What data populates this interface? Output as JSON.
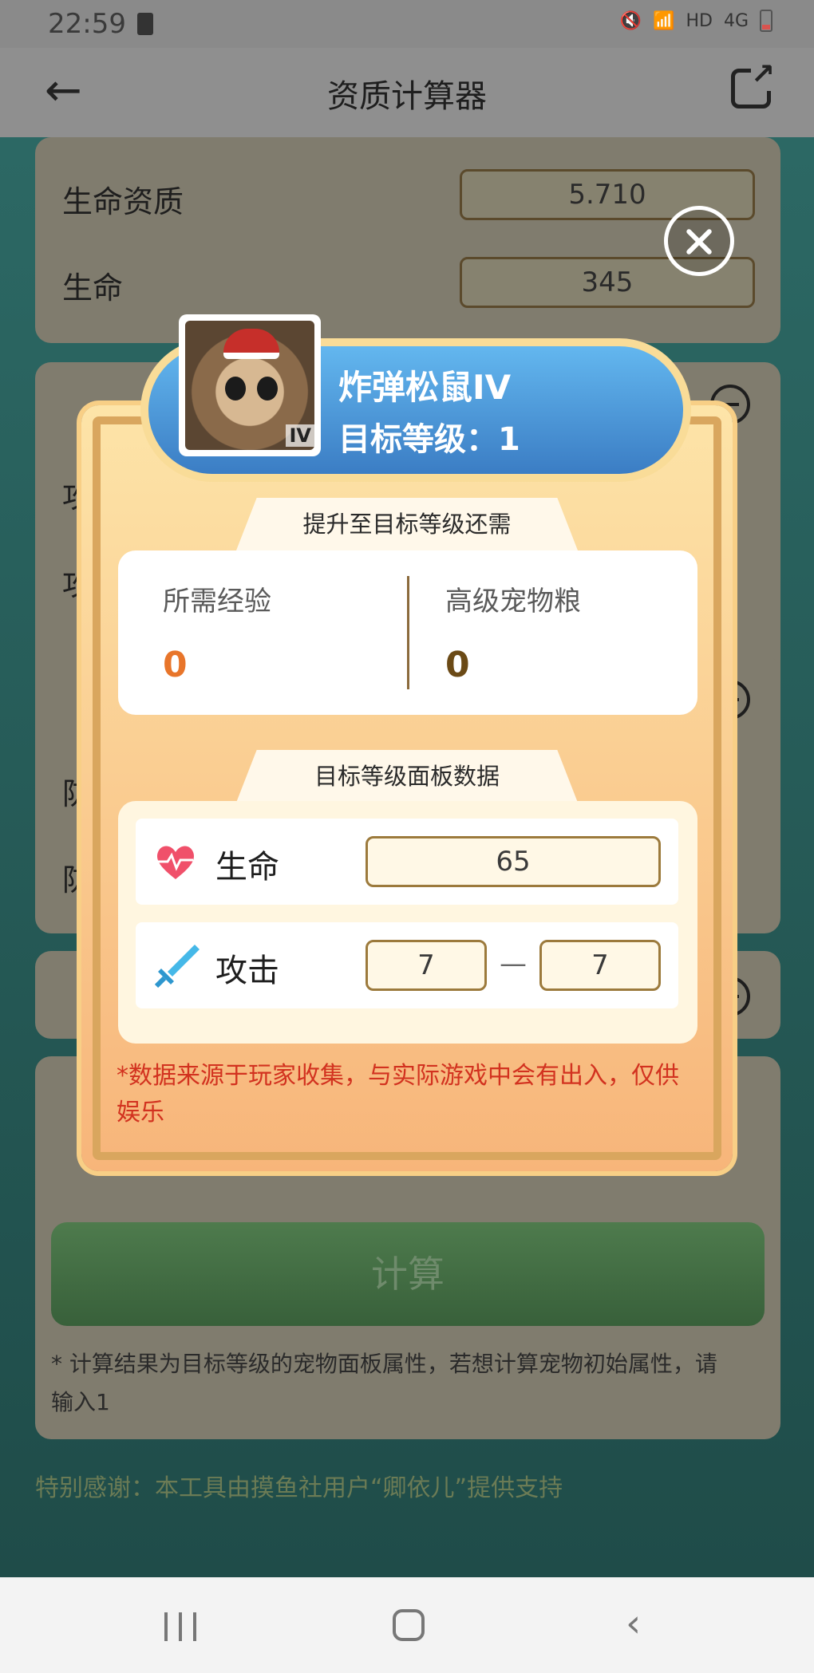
{
  "status_bar": {
    "time": "22:59",
    "network_label": "HD",
    "signal_label": "4G"
  },
  "header": {
    "title": "资质计算器"
  },
  "background_form": {
    "life_aptitude_label": "生命资质",
    "life_aptitude_value": "5.710",
    "life_label": "生命",
    "life_value": "345",
    "attack_row1_label_partial": "攻",
    "attack_row2_label_partial": "攻",
    "defense_row1_label_partial": "防",
    "defense_row2_label_partial": "防",
    "calc_button": "计算",
    "calc_note": "* 计算结果为目标等级的宠物面板属性，若想计算宠物初始属性，请输入1",
    "thanks": "特别感谢：本工具由摸鱼社用户“卿依儿”提供支持"
  },
  "modal": {
    "pet_name": "炸弹松鼠IV",
    "pet_grade": "IV",
    "target_level": "目标等级：1",
    "required_tab": "提升至目标等级还需",
    "exp_label": "所需经验",
    "exp_value": "0",
    "food_label": "高级宠物粮",
    "food_value": "0",
    "panel_tab": "目标等级面板数据",
    "hp_label": "生命",
    "hp_value": "65",
    "attack_label": "攻击",
    "attack_min": "7",
    "attack_dash": "—",
    "attack_max": "7",
    "disclaimer": "*数据来源于玩家收集，与实际游戏中会有出入，仅供娱乐"
  },
  "colors": {
    "exp_value": "#e8752a",
    "food_value": "#6b4a16",
    "disclaimer": "#d2321f",
    "banner": "#4a90d9"
  }
}
